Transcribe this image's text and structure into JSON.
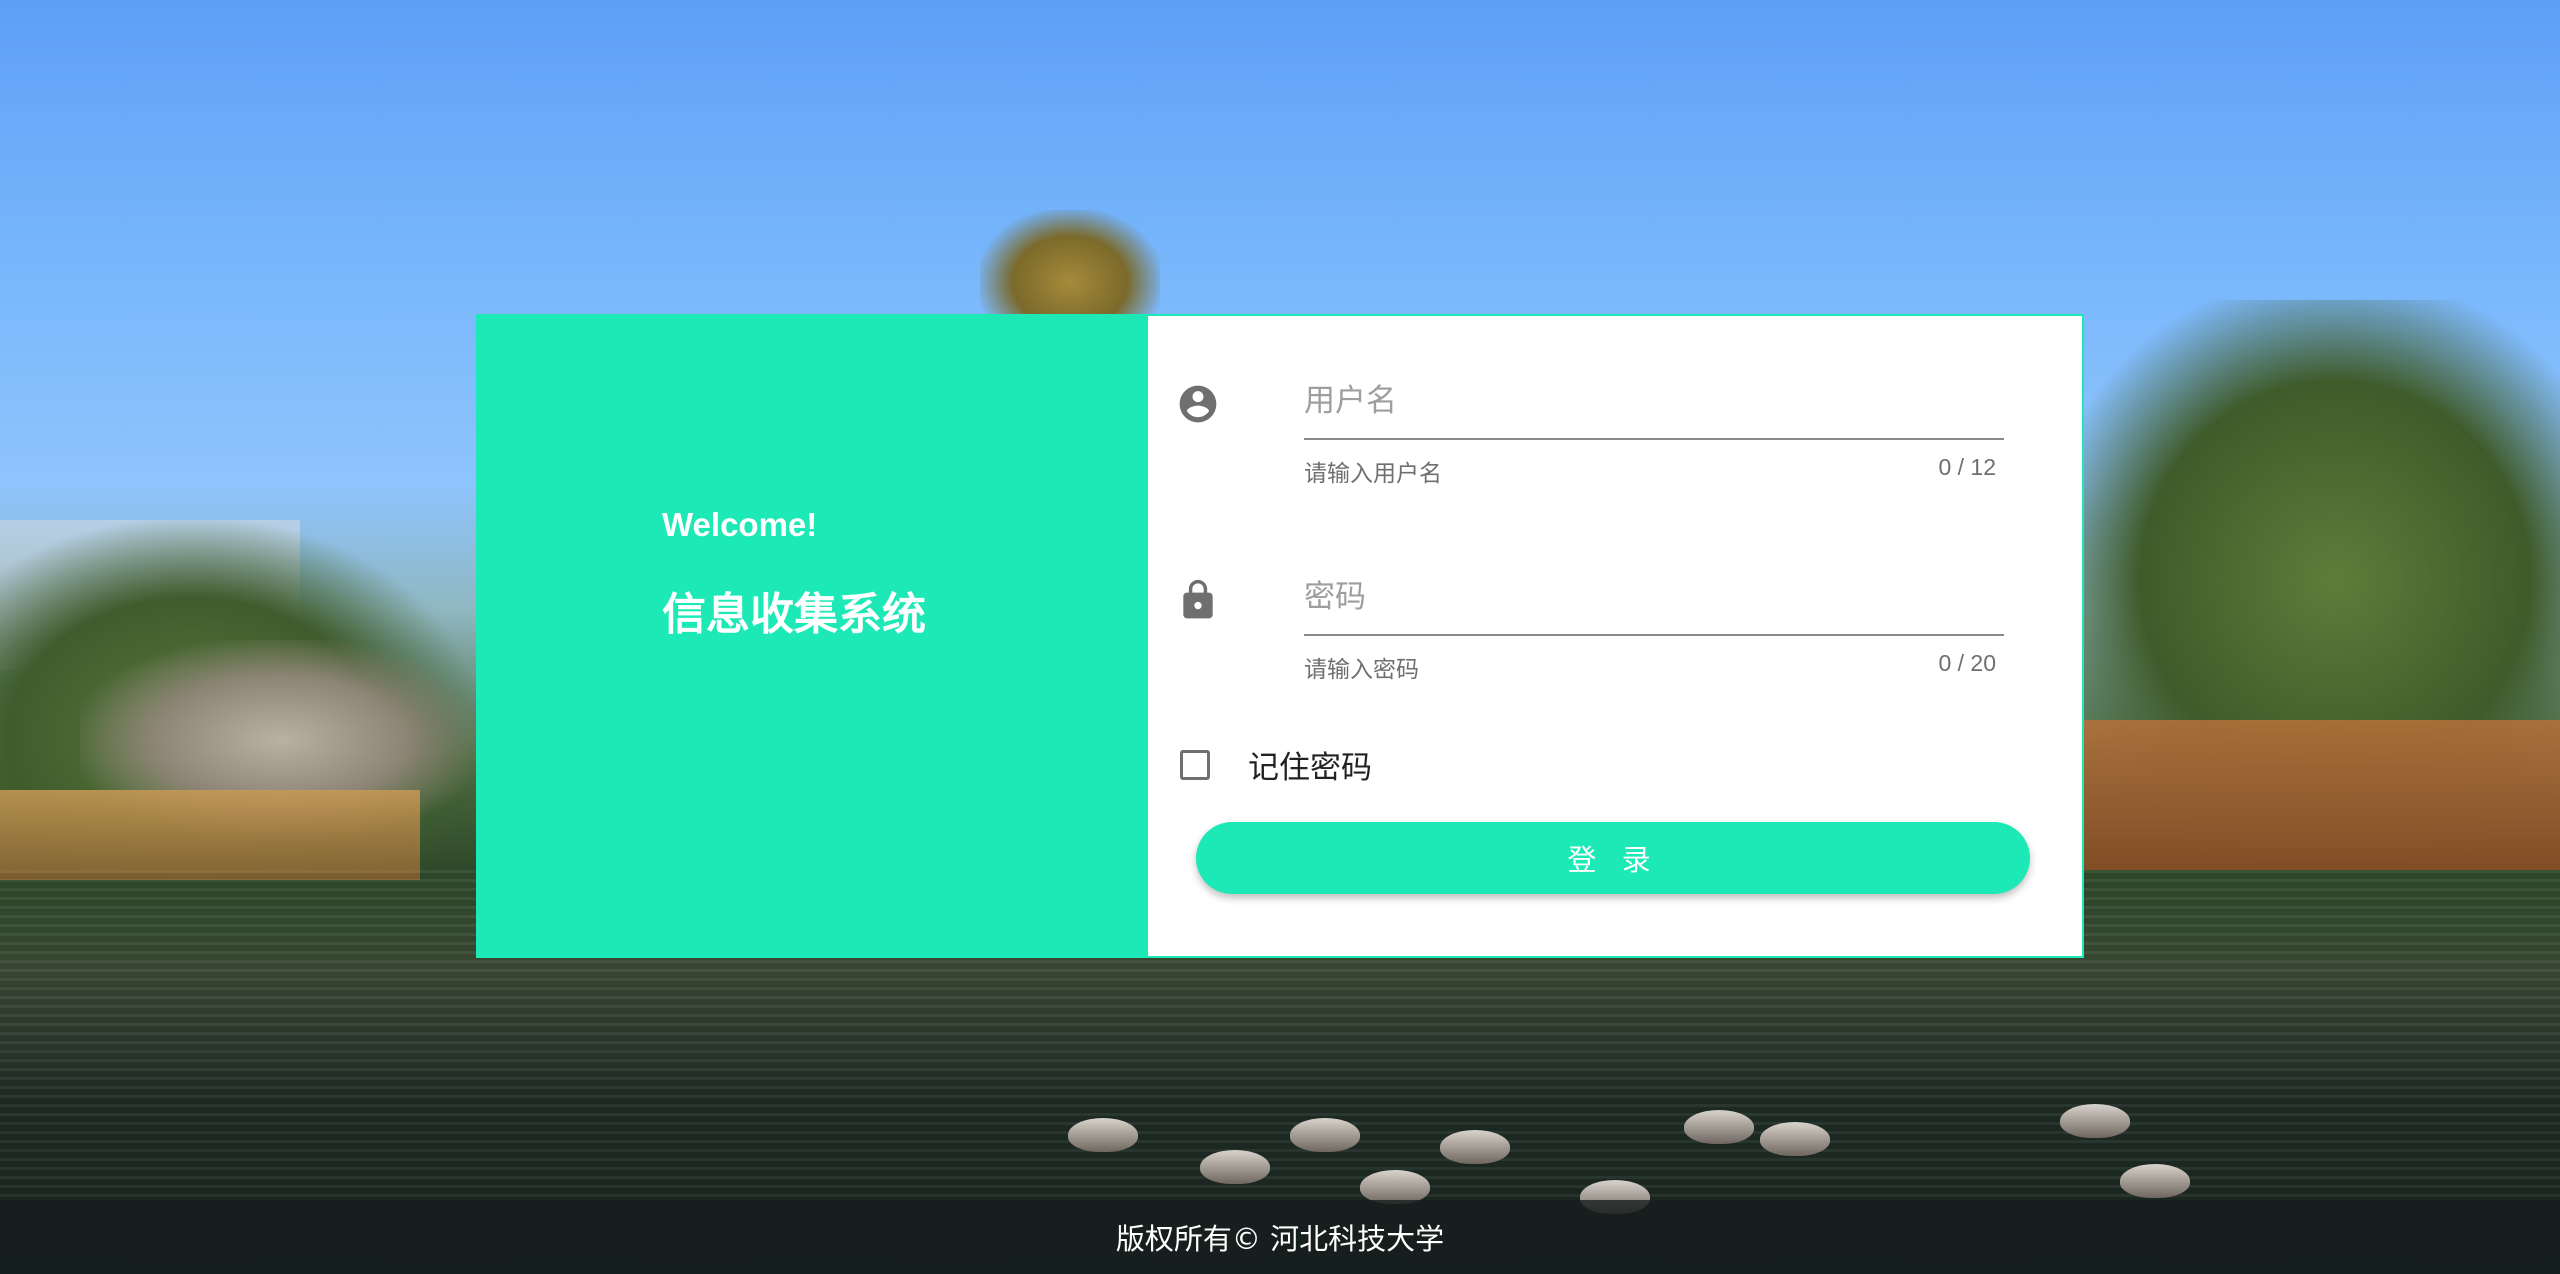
{
  "welcome": {
    "greeting": "Welcome!",
    "system_title": "信息收集系统"
  },
  "login_form": {
    "username": {
      "placeholder": "用户名",
      "value": "",
      "hint": "请输入用户名",
      "counter": "0 / 12",
      "icon": "account-circle-icon"
    },
    "password": {
      "placeholder": "密码",
      "value": "",
      "hint": "请输入密码",
      "counter": "0 / 20",
      "icon": "lock-icon"
    },
    "remember": {
      "label": "记住密码",
      "checked": false
    },
    "submit_label": "登 录"
  },
  "footer": {
    "copyright": "版权所有© 河北科技大学"
  },
  "colors": {
    "accent": "#1de9b6",
    "card_right_bg": "#ffffff",
    "footer_bg": "rgba(20,28,30,0.78)",
    "icon_gray": "#6f6f6f"
  }
}
